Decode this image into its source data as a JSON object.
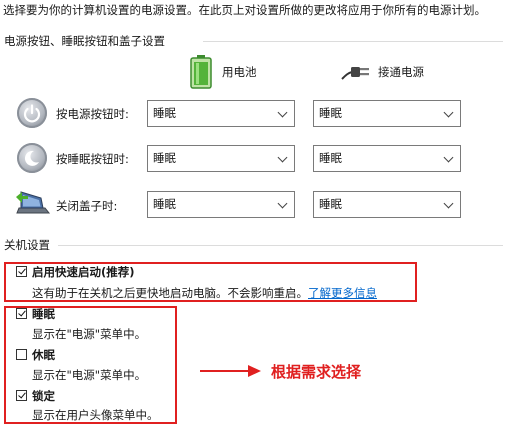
{
  "intro_text": "选择要为你的计算机设置的电源设置。在此页上对设置所做的更改将应用于你所有的电源计划。",
  "buttons_section": {
    "title": "电源按钮、睡眠按钮和盖子设置",
    "col_battery": "用电池",
    "col_plugged": "接通电源",
    "rows": [
      {
        "label": "按电源按钮时:",
        "battery": "睡眠",
        "plugged": "睡眠"
      },
      {
        "label": "按睡眠按钮时:",
        "battery": "睡眠",
        "plugged": "睡眠"
      },
      {
        "label": "关闭盖子时:",
        "battery": "睡眠",
        "plugged": "睡眠"
      }
    ]
  },
  "shutdown_section": {
    "title": "关机设置",
    "options": [
      {
        "label": "启用快速启动(推荐)",
        "checked": true,
        "desc": "这有助于在关机之后更快地启动电脑。不会影响重启。",
        "link": "了解更多信息"
      },
      {
        "label": "睡眠",
        "checked": true,
        "desc": "显示在\"电源\"菜单中。"
      },
      {
        "label": "休眠",
        "checked": false,
        "desc": "显示在\"电源\"菜单中。"
      },
      {
        "label": "锁定",
        "checked": true,
        "desc": "显示在用户头像菜单中。"
      }
    ]
  },
  "annotation": {
    "text": "根据需求选择",
    "color": "#e02020"
  }
}
